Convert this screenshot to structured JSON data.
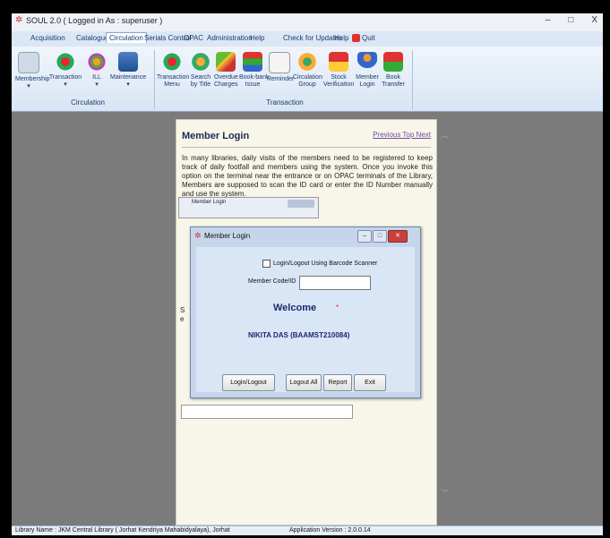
{
  "window": {
    "title": "SOUL 2.0 ( Logged in As : superuser )",
    "controls": [
      "–",
      "□",
      "X"
    ]
  },
  "menu_tabs": [
    "Acquisition",
    "Catalogue",
    "Circulation",
    "Serials Control",
    "OPAC",
    "Administration",
    "Help"
  ],
  "menu_extra": {
    "check_updates": "Check for Updates",
    "help": "Help",
    "quit": "Quit"
  },
  "ribbon": {
    "circulation_group": {
      "label": "Circulation",
      "buttons": [
        "Membership",
        "Transaction",
        "ILL",
        "Maintenance"
      ]
    },
    "transaction_group": {
      "label": "Transaction",
      "buttons": [
        "Transaction\nMenu",
        "Search\nby Title",
        "Overdue\nCharges",
        "Book-bank\nIssue",
        "Reminder",
        "Circulation\nGroup",
        "Stock\nVerification",
        "Member\nLogin",
        "Book\nTransfer"
      ]
    }
  },
  "help_panel": {
    "title": "Member Login",
    "nav": "Previous Top Next",
    "text": "In many libraries, daily visits of the members need to be registered to keep track of daily footfall and members using the system. Once you invoke this option on the terminal near the entrance or on OPAC terminals of the Library, Members are supposed to scan the ID card or enter the ID Number manually and use the system.",
    "thumb_title": "Member Login",
    "side_s": "S",
    "side_e": "e"
  },
  "dialog": {
    "title": "Member Login",
    "checkbox_label": "Login/Logout Using Barcode Scanner",
    "member_label": "Member Code/ID",
    "member_value": "",
    "welcome": "Welcome",
    "required_mark": "*",
    "user": "NIKITA DAS (BAAMST210084)",
    "buttons": {
      "login_logout": "Login/Logout",
      "logout_all": "Logout All",
      "report": "Report",
      "exit": "Exit"
    }
  },
  "status": {
    "library": "Library Name : JKM Central Library ( Jorhat Kendriya Mahabidyalaya), Jorhat",
    "version": "Application Version : 2.0.0.14"
  },
  "colors": {
    "accent": "#1d2a6e",
    "ribbon_text": "#1c3a6e",
    "close_red": "#c8403a",
    "panel_bg": "#f8f6e8"
  }
}
